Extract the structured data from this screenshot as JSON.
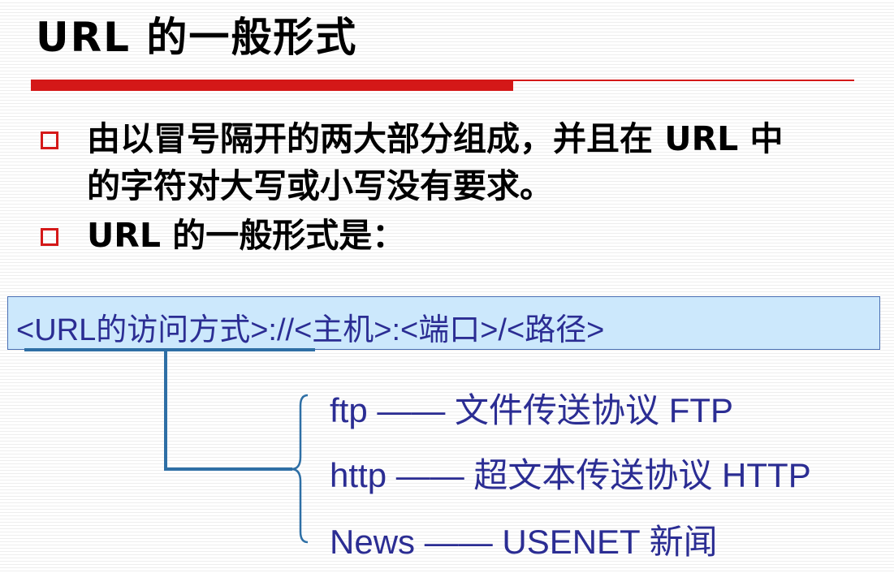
{
  "slide": {
    "title": "URL 的一般形式",
    "bullets": [
      {
        "lines": [
          "由以冒号隔开的两大部分组成，并且在 URL 中",
          "的字符对大写或小写没有要求。"
        ]
      },
      {
        "lines": [
          "URL 的一般形式是："
        ]
      }
    ],
    "url_format": "<URL的访问方式>://<主机>:<端口>/<路径>",
    "protocols": [
      "ftp —— 文件传送协议 FTP",
      "http —— 超文本传送协议 HTTP",
      "News —— USENET 新闻"
    ]
  },
  "colors": {
    "accent_red": "#d41818",
    "text_blue": "#2b2d93",
    "box_fill": "#cce8fc",
    "connector_blue": "#2e6fa5"
  }
}
